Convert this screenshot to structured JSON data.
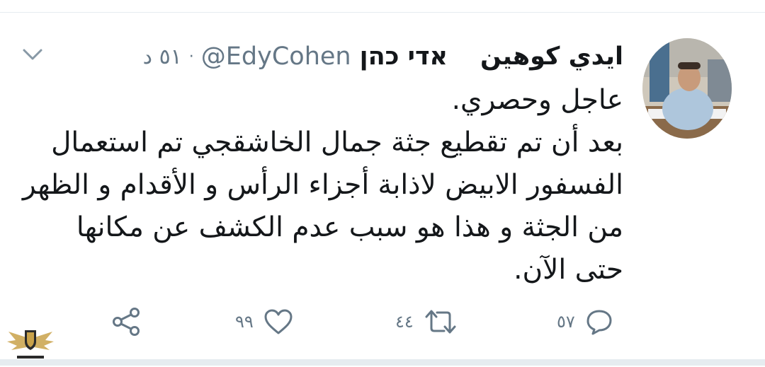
{
  "tweet": {
    "author_name_ar": "ايدي كوهين",
    "author_name_he": "אדי כהן",
    "handle": "@EdyCohen",
    "separator": "·",
    "time": "٥١ د",
    "lines": [
      "عاجل وحصري.",
      "بعد أن تم تقطيع جثة جمال الخاشقجي تم استعمال",
      "الفسفور الابيض لاذابة أجزاء الرأس و الأقدام و الظهر",
      "من الجثة  و هذا هو سبب عدم الكشف عن مكانها",
      "حتى الآن."
    ]
  },
  "actions": {
    "reply_count": "٥٧",
    "retweet_count": "٤٤",
    "like_count": "٩٩"
  },
  "icons": {
    "reply": "reply-icon",
    "retweet": "retweet-icon",
    "like": "heart-icon",
    "share": "share-icon",
    "more": "chevron-down-icon"
  },
  "colors": {
    "text": "#14171a",
    "secondary": "#657786",
    "divider": "#e6ecf0"
  }
}
